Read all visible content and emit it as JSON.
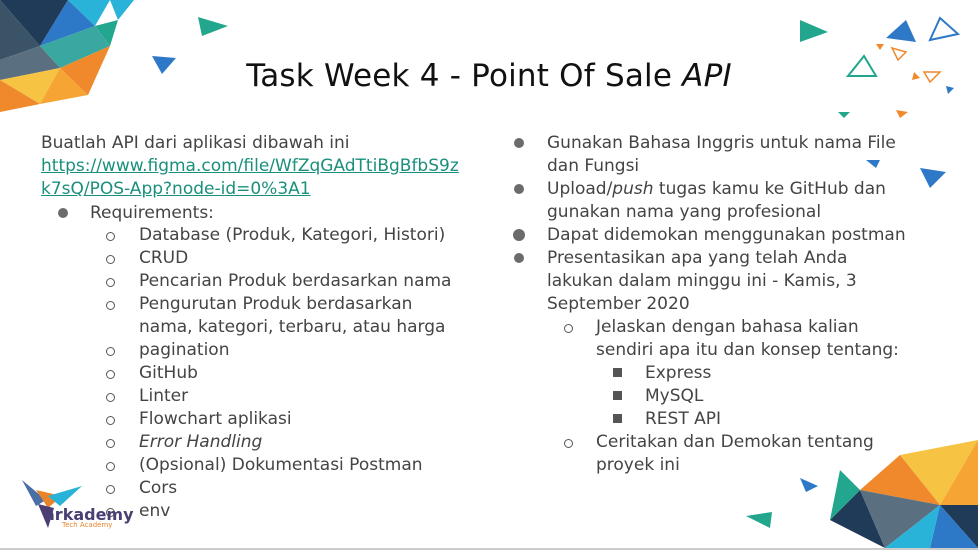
{
  "slide": {
    "title_main": "Task Week 4 - Point Of Sale ",
    "title_italic": "API",
    "left": {
      "intro": "Buatlah API dari aplikasi dibawah ini",
      "link_line1": "https://www.figma.com/file/WfZqGAdTtiBgBfbS9z",
      "link_line2": "k7sQ/POS-App?node-id=0%3A1",
      "requirements_label": "Requirements:",
      "items": [
        "Database (Produk, Kategori, Histori)",
        "CRUD",
        "Pencarian Produk berdasarkan nama",
        "Pengurutan Produk berdasarkan",
        "nama, kategori, terbaru, atau harga",
        "pagination",
        "GitHub",
        "Linter",
        "Flowchart aplikasi",
        "Error Handling",
        "(Opsional) Dokumentasi Postman",
        "Cors",
        "env"
      ]
    },
    "right": {
      "b1_l1": "Gunakan Bahasa Inggris untuk nama File",
      "b1_l2": "dan Fungsi",
      "b2_l1_pre": "Upload/",
      "b2_l1_it": "push",
      "b2_l1_post": " tugas kamu ke GitHub dan",
      "b2_l2": "gunakan nama yang profesional",
      "b3": "Dapat didemokan menggunakan postman",
      "b4_l1": "Presentasikan apa yang telah Anda",
      "b4_l2": "lakukan dalam minggu ini - Kamis, 3",
      "b4_l3": "September 2020",
      "sub1_l1": "Jelaskan dengan bahasa kalian",
      "sub1_l2": "sendiri apa itu dan konsep tentang:",
      "tech": [
        "Express",
        "MySQL",
        "REST API"
      ],
      "sub2_l1": "Ceritakan dan Demokan tentang",
      "sub2_l2": "proyek ini"
    },
    "logo": {
      "name": "arkademy",
      "tagline": "Tech Academy"
    }
  },
  "colors": {
    "link": "#1a8f7c",
    "orange": "#f0892b",
    "yellow": "#f6c343",
    "navy": "#1f3b57",
    "blue": "#2e79c7",
    "teal": "#22a68d",
    "cyan": "#2ab3d8",
    "slate": "#5a6f80"
  }
}
